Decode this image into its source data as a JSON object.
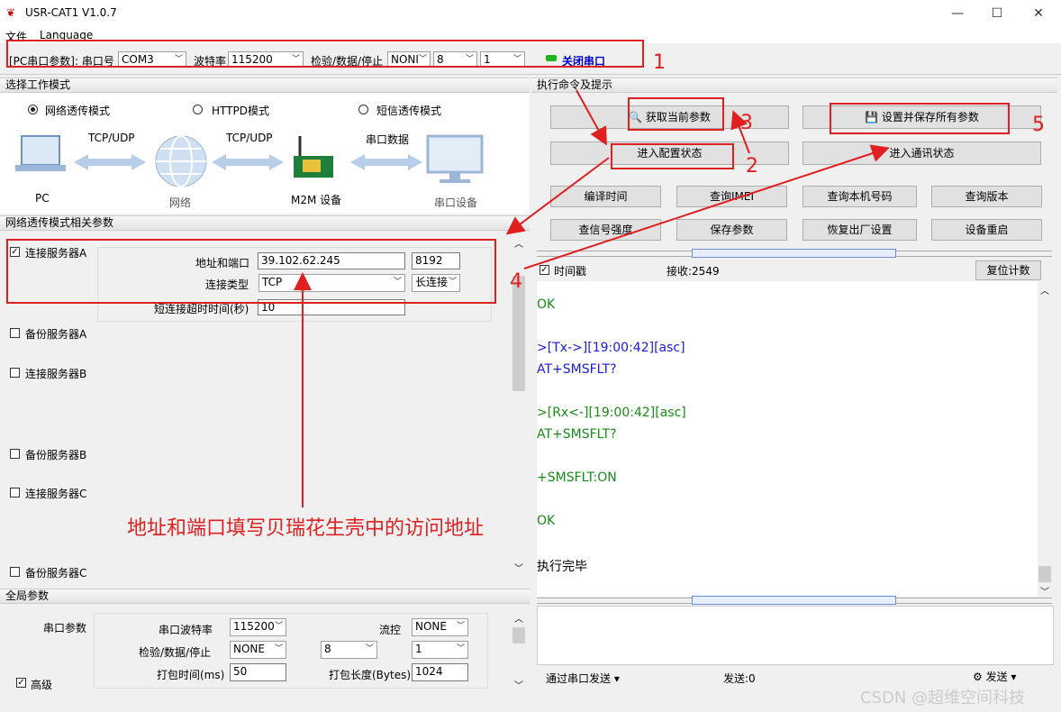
{
  "window": {
    "title": "USR-CAT1 V1.0.7",
    "min": "—",
    "max": "☐",
    "close": "✕"
  },
  "menu": {
    "file": "文件",
    "language": "Language"
  },
  "toolbar": {
    "serial_label": "[PC串口参数]: 串口号",
    "port": "COM3",
    "baud_label": "波特率",
    "baud": "115200",
    "parity_label": "检验/数据/停止",
    "parity": "NONI",
    "data_bits": "8",
    "stop_bits": "1",
    "close_port": "关闭串口"
  },
  "work_mode": {
    "header": "选择工作模式",
    "modes": [
      "网络透传模式",
      "HTTPD模式",
      "短信透传模式"
    ],
    "selected": 0,
    "diagram": {
      "pc": "PC",
      "net": "网络",
      "m2m": "M2M 设备",
      "serial_dev": "串口设备",
      "link1": "TCP/UDP",
      "link2": "TCP/UDP",
      "link3": "串口数据"
    }
  },
  "net_params": {
    "header": "网络透传模式相关参数",
    "server_a": "连接服务器A",
    "server_a_checked": true,
    "addr_label": "地址和端口",
    "addr": "39.102.62.245",
    "port": "8192",
    "conn_type_label": "连接类型",
    "conn_type": "TCP",
    "conn_mode": "长连接",
    "short_timeout_label": "短连接超时时间(秒)",
    "short_timeout": "10",
    "backup_a": "备份服务器A",
    "server_b": "连接服务器B",
    "backup_b": "备份服务器B",
    "server_c": "连接服务器C",
    "backup_c": "备份服务器C"
  },
  "global": {
    "header": "全局参数",
    "serial_params": "串口参数",
    "baud_label": "串口波特率",
    "baud": "115200",
    "flow_label": "流控",
    "flow": "NONE",
    "parity_label": "检验/数据/停止",
    "parity": "NONE",
    "data_bits": "8",
    "stop_bits": "1",
    "pack_time_label": "打包时间(ms)",
    "pack_time": "50",
    "pack_len_label": "打包长度(Bytes)",
    "pack_len": "1024",
    "advanced": "高级"
  },
  "commands": {
    "header": "执行命令及提示",
    "get_params": "获取当前参数",
    "save_all": "设置并保存所有参数",
    "enter_config": "进入配置状态",
    "enter_comm": "进入通讯状态",
    "row1": [
      "编译时间",
      "查询IMEI",
      "查询本机号码",
      "查询版本"
    ],
    "row2": [
      "查信号强度",
      "保存参数",
      "恢复出厂设置",
      "设备重启"
    ]
  },
  "log": {
    "timestamp": "时间戳",
    "recv": "接收:2549",
    "reset": "复位计数",
    "lines": [
      "OK",
      ">[Tx->][19:00:42][asc]",
      "AT+SMSFLT?",
      ">[Rx<-][19:00:42][asc]",
      "AT+SMSFLT?",
      "+SMSFLT:ON",
      "OK",
      "执行完毕"
    ]
  },
  "send": {
    "via_serial": "通过串口发送",
    "sent": "发送:0",
    "send_btn": "发送"
  },
  "annotations": {
    "n1": "1",
    "n2": "2",
    "n3": "3",
    "n4": "4",
    "n5": "5",
    "note": "地址和端口填写贝瑞花生壳中的访问地址"
  },
  "watermark": "CSDN @超维空间科技",
  "colors": {
    "annotation_red": "#e02020",
    "tx_blue": "#1a1adc",
    "rx_green": "#1a8a1a"
  }
}
